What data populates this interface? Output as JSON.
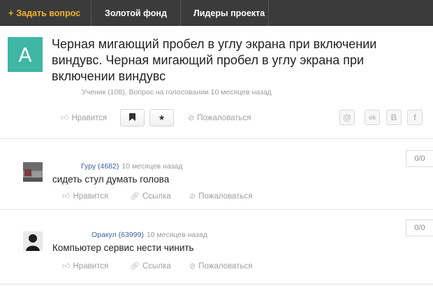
{
  "nav": {
    "ask_plus": "+",
    "ask_label": "Задать вопрос",
    "gold_label": "Золотой фонд",
    "leaders_label": "Лидеры проекта"
  },
  "question": {
    "avatar_letter": "A",
    "title": "Черная мигающий пробел в углу экрана при включении виндувс. Черная мигающий пробел в углу экрана при включении виндувс",
    "meta": "Ученик (108), Вопрос на голосовании 10 месяцев назад",
    "like_label": "Нравится",
    "report_label": "Пожаловаться",
    "share": [
      "@",
      "ok",
      "B",
      "f"
    ]
  },
  "answers": [
    {
      "author": "Гуру (4682)",
      "time": "10 месяцев назад",
      "text": "сидеть стул думать голова",
      "votes": "0/0",
      "like_label": "Нравится",
      "link_label": "Ссылка",
      "report_label": "Пожаловаться"
    },
    {
      "author": "Оракул (63999)",
      "time": "10 месяцев назад",
      "text": "Компьютер сервис нести чинить",
      "votes": "0/0",
      "like_label": "Нравится",
      "link_label": "Ссылка",
      "report_label": "Пожаловаться"
    }
  ],
  "colors": {
    "nav_bg": "#3b3b3b",
    "ask_accent": "#f3b32c",
    "avatar_teal": "#3fb6a6",
    "author_link": "#3a5fa0"
  }
}
